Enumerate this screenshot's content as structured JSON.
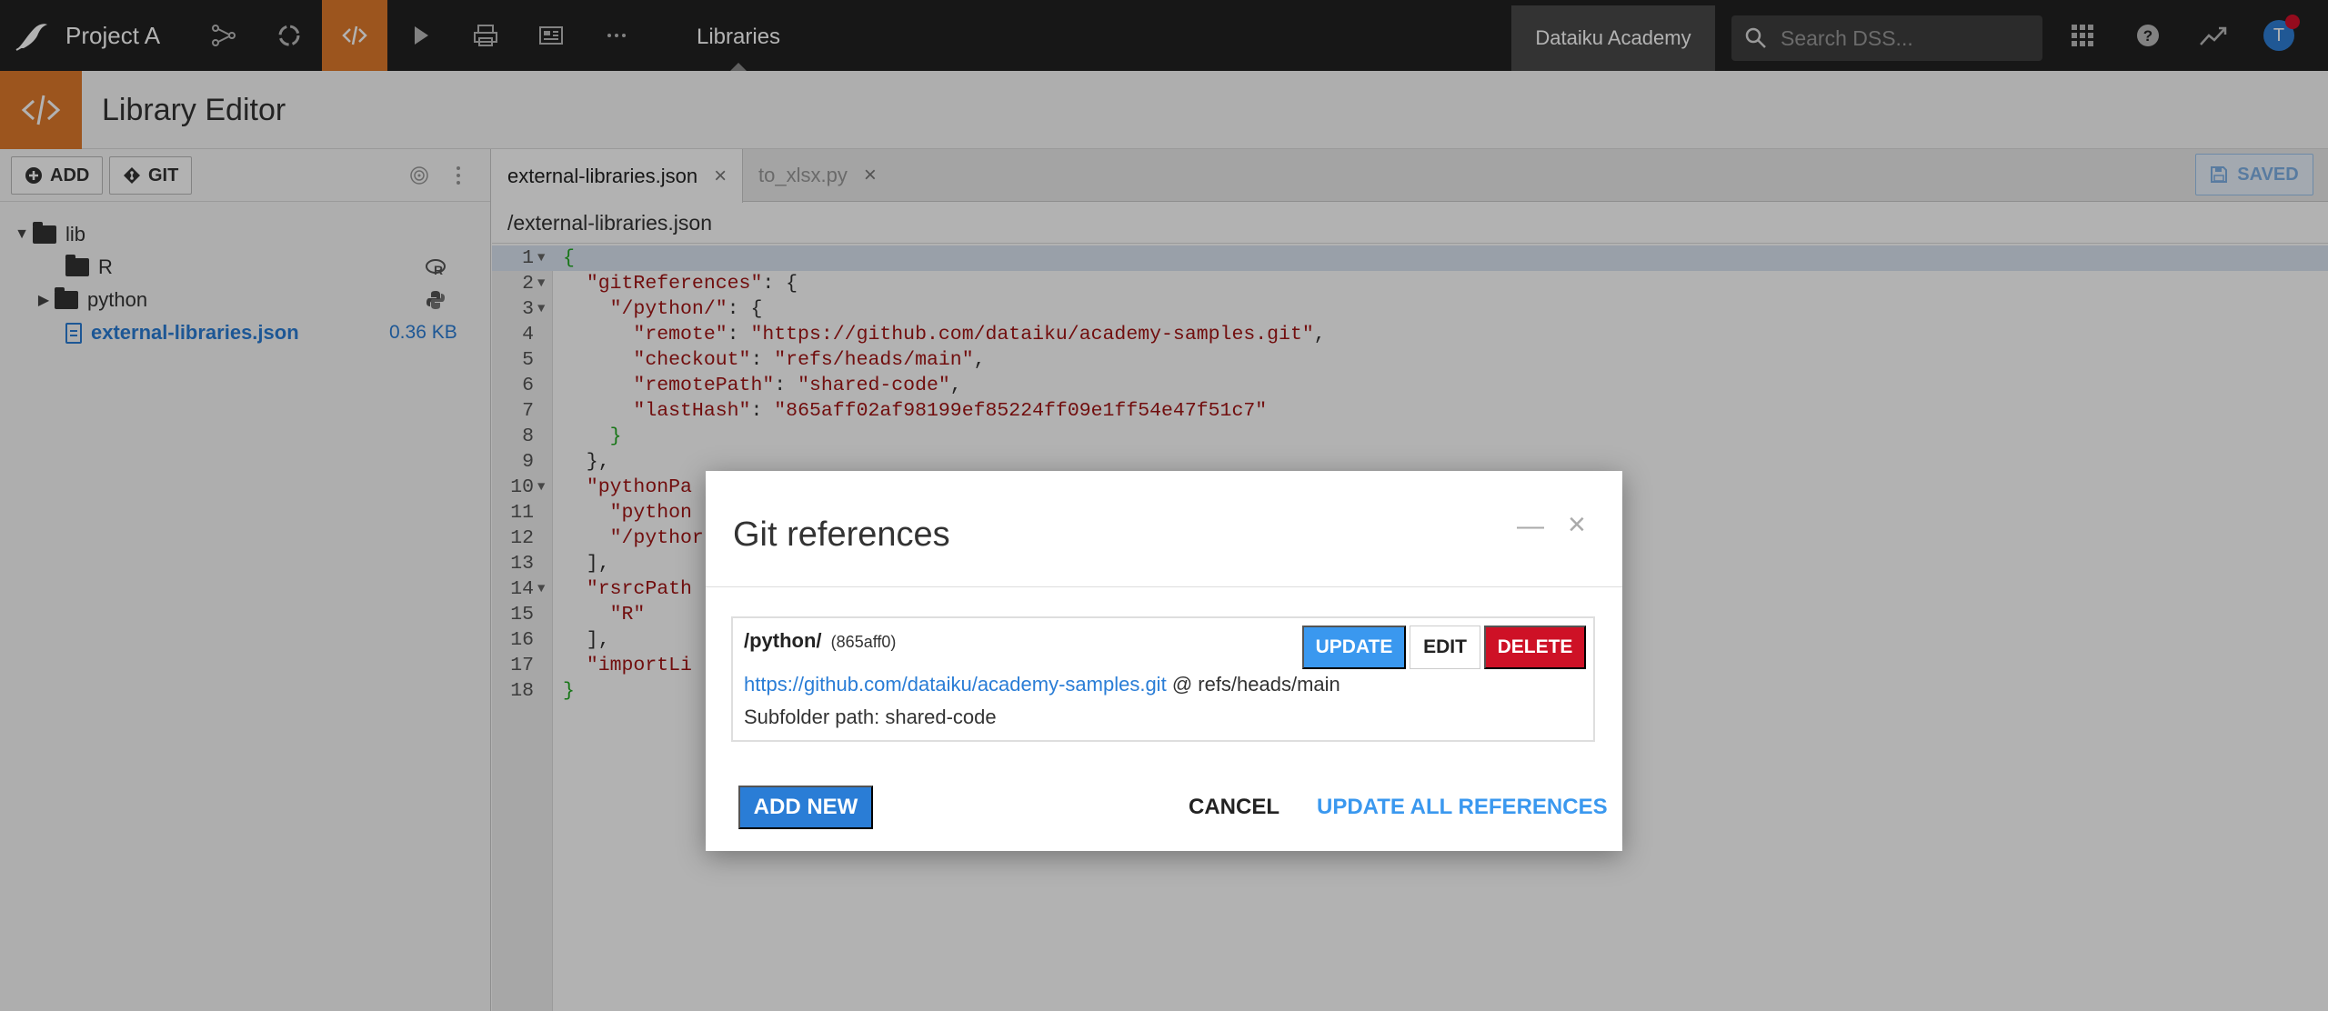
{
  "nav": {
    "project_name": "Project A",
    "section": "Libraries",
    "academy": "Dataiku Academy",
    "search_placeholder": "Search DSS...",
    "avatar_initial": "T",
    "icons": [
      "bird-logo-icon",
      "flow-icon",
      "cycle-icon",
      "code-icon",
      "play-icon",
      "print-icon",
      "dashboard-icon",
      "more-icon",
      "apps-grid-icon",
      "help-icon",
      "activity-icon"
    ]
  },
  "subheader": {
    "title": "Library Editor"
  },
  "toolbar": {
    "add_label": "ADD",
    "git_label": "GIT"
  },
  "tree": {
    "root": "lib",
    "items": [
      {
        "name": "R",
        "type": "folder"
      },
      {
        "name": "python",
        "type": "folder"
      },
      {
        "name": "external-libraries.json",
        "type": "file",
        "size": "0.36 KB"
      }
    ]
  },
  "tabs": [
    {
      "label": "external-libraries.json",
      "active": true
    },
    {
      "label": "to_xlsx.py",
      "active": false
    }
  ],
  "saved_label": "SAVED",
  "file_path": "/external-libraries.json",
  "code_lines": [
    "{",
    "  \"gitReferences\": {",
    "    \"/python/\": {",
    "      \"remote\": \"https://github.com/dataiku/academy-samples.git\",",
    "      \"checkout\": \"refs/heads/main\",",
    "      \"remotePath\": \"shared-code\",",
    "      \"lastHash\": \"865aff02af98199ef85224ff09e1ff54e47f51c7\"",
    "    }",
    "  },",
    "  \"pythonPa",
    "    \"python",
    "    \"/pythor",
    "  ],",
    "  \"rsrcPath",
    "    \"R\"",
    "  ],",
    "  \"importLi",
    "}"
  ],
  "modal": {
    "title": "Git references",
    "ref_name": "/python/",
    "ref_hash": "(865aff0)",
    "update_label": "UPDATE",
    "edit_label": "EDIT",
    "delete_label": "DELETE",
    "url": "https://github.com/dataiku/academy-samples.git",
    "checkout_text": "@ refs/heads/main",
    "subfolder": "Subfolder path: shared-code",
    "add_new_label": "ADD NEW",
    "cancel_label": "CANCEL",
    "update_all_label": "UPDATE ALL REFERENCES"
  },
  "colors": {
    "accent": "#e07a2b",
    "primary": "#2a7dd6",
    "danger": "#ce1126",
    "nav_bg": "#222222"
  }
}
